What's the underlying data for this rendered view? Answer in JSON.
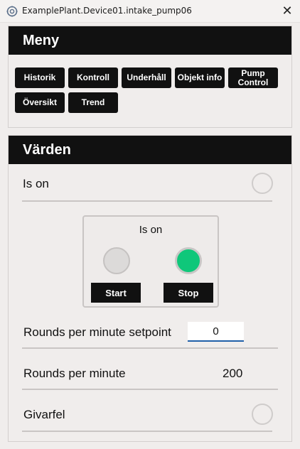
{
  "window": {
    "title": "ExamplePlant.Device01.intake_pump06",
    "close_glyph": "✕",
    "icons": {
      "app": "gear-icon",
      "close": "close-icon"
    }
  },
  "menu": {
    "header": "Meny",
    "buttons": [
      {
        "label": "Historik"
      },
      {
        "label": "Kontroll"
      },
      {
        "label": "Underhåll"
      },
      {
        "label": "Objekt info"
      },
      {
        "label": "Pump Control"
      },
      {
        "label": "Översikt"
      },
      {
        "label": "Trend"
      }
    ]
  },
  "values": {
    "header": "Värden",
    "is_on": {
      "label": "Is on",
      "state": "off"
    },
    "faceplate": {
      "title": "Is on",
      "start_label": "Start",
      "stop_label": "Stop",
      "start_lamp": "off",
      "stop_lamp": "on"
    },
    "setpoint": {
      "label": "Rounds per minute setpoint",
      "value": "0"
    },
    "rpm": {
      "label": "Rounds per minute",
      "value": "200"
    },
    "givarfel": {
      "label": "Givarfel",
      "state": "off"
    }
  },
  "colors": {
    "header_bg": "#111111",
    "lamp_on": "#0fc77a",
    "lamp_off": "#dcdad9",
    "input_underline": "#1f5fa8"
  }
}
